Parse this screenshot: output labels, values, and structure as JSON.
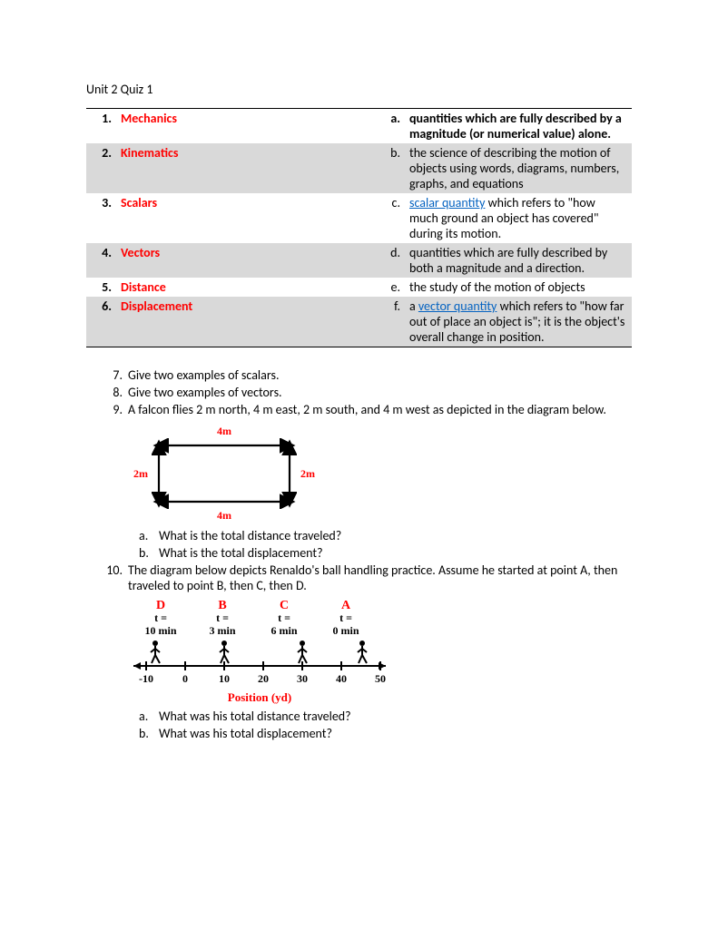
{
  "title": "Unit 2 Quiz 1",
  "match_rows": [
    {
      "num": "1.",
      "term": "Mechanics",
      "let": "a.",
      "def_pre": "quantities which are fully described by a magnitude (or numerical value) alone.",
      "bold": true,
      "shade": false
    },
    {
      "num": "2.",
      "term": "Kinematics",
      "let": "b.",
      "def_pre": "the science of describing the motion of objects using words, diagrams, numbers, graphs, and equations",
      "bold": false,
      "shade": true
    },
    {
      "num": "3.",
      "term": "Scalars",
      "let": "c.",
      "link": "scalar quantity",
      "def_post": " which refers to \"how much ground an object has covered\" during its motion.",
      "bold": false,
      "shade": false
    },
    {
      "num": "4.",
      "term": "Vectors",
      "let": "d.",
      "def_pre": "quantities which are fully described by both a magnitude and a direction.",
      "bold": false,
      "shade": true
    },
    {
      "num": "5.",
      "term": "Distance",
      "let": "e.",
      "def_pre": "the study of the motion of objects",
      "bold": false,
      "shade": false
    },
    {
      "num": "6.",
      "term": "Displacement",
      "let": "f.",
      "def_pre": "a ",
      "link": "vector quantity",
      "def_post": " which refers to \"how far out of place an object is\"; it is the object's overall change in position.",
      "bold": false,
      "shade": true
    }
  ],
  "q7": {
    "n": "7.",
    "t": "Give two examples of scalars."
  },
  "q8": {
    "n": "8.",
    "t": "Give two examples of vectors."
  },
  "q9": {
    "n": "9.",
    "t": "A falcon flies 2 m north, 4 m east, 2 m south, and 4 m west as depicted in the diagram below."
  },
  "rect": {
    "top": "4m",
    "left": "2m",
    "right": "2m",
    "bottom": "4m"
  },
  "q9a": {
    "n": "a.",
    "t": "What is the total distance traveled?"
  },
  "q9b": {
    "n": "b.",
    "t": "What is the total displacement?"
  },
  "q10": {
    "n": "10.",
    "t": "The diagram below depicts Renaldo's ball handling practice.  Assume he started at point A, then traveled to point B, then C, then D."
  },
  "nl": {
    "cols": [
      {
        "letter": "D",
        "t1": "t =",
        "t2": "10 min"
      },
      {
        "letter": "B",
        "t1": "t =",
        "t2": "3 min"
      },
      {
        "letter": "C",
        "t1": "t =",
        "t2": "6 min"
      },
      {
        "letter": "A",
        "t1": "t =",
        "t2": "0 min"
      }
    ],
    "ticks": [
      "-10",
      "0",
      "10",
      "20",
      "30",
      "40",
      "50"
    ],
    "axis_label": "Position (yd)"
  },
  "q10a": {
    "n": "a.",
    "t": "What was his total distance traveled?"
  },
  "q10b": {
    "n": "b.",
    "t": "What was his total displacement?"
  }
}
